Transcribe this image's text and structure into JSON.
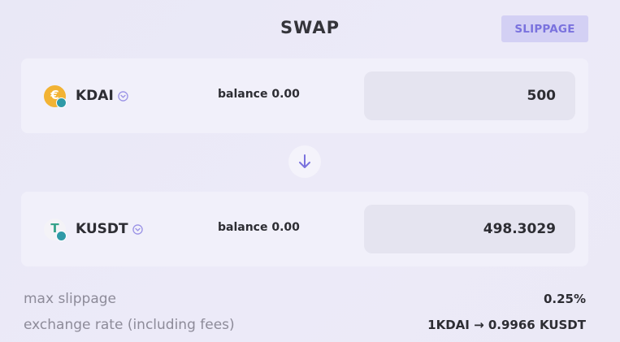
{
  "header": {
    "title": "SWAP",
    "slippage_label": "SLIPPAGE"
  },
  "from": {
    "token": "KDAI",
    "token_symbol_glyph": "€",
    "balance": "balance 0.00",
    "amount": "500"
  },
  "to": {
    "token": "KUSDT",
    "token_symbol_glyph": "T",
    "balance": "balance 0.00",
    "amount": "498.3029"
  },
  "info": {
    "max_slippage_label": "max slippage",
    "max_slippage_value": "0.25%",
    "exchange_rate_label": "exchange rate (including fees)",
    "exchange_rate_value": "1KDAI → 0.9966 KUSDT"
  },
  "colors": {
    "accent": "#7a72de",
    "kdai_logo": "#f2b334",
    "kusdt_logo": "#36a38b"
  },
  "icons": {
    "chevron": "chevron-down-icon",
    "switch": "arrow-down-icon"
  }
}
